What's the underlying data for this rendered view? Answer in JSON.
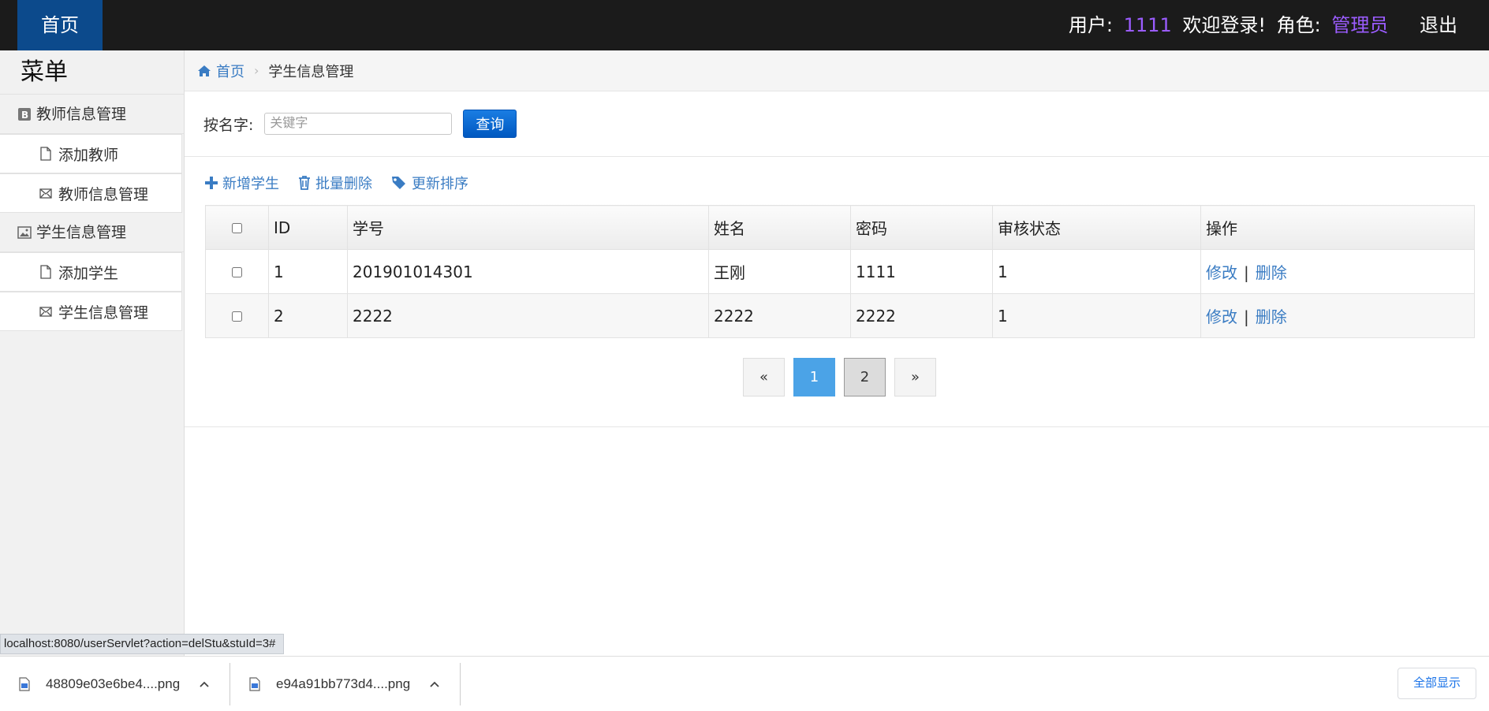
{
  "topbar": {
    "home": "首页",
    "user_label": "用户:",
    "user_name": "1111",
    "welcome": "欢迎登录!",
    "role_label": "角色:",
    "role_name": "管理员",
    "logout": "退出",
    "accent": "#9b5cff"
  },
  "sidebar": {
    "title": "菜单",
    "groups": [
      {
        "label": "教师信息管理",
        "icon": "bootstrap-icon",
        "items": [
          {
            "label": "添加教师",
            "icon": "file-icon"
          },
          {
            "label": "教师信息管理",
            "icon": "envelope-icon"
          }
        ]
      },
      {
        "label": "学生信息管理",
        "icon": "picture-icon",
        "items": [
          {
            "label": "添加学生",
            "icon": "file-icon"
          },
          {
            "label": "学生信息管理",
            "icon": "envelope-icon"
          }
        ]
      }
    ]
  },
  "breadcrumb": {
    "home": "首页",
    "current": "学生信息管理"
  },
  "search": {
    "label": "按名字:",
    "placeholder": "关键字",
    "value": "",
    "button": "查询"
  },
  "actions": {
    "add": "新增学生",
    "batch_delete": "批量删除",
    "reorder": "更新排序"
  },
  "table": {
    "headers": [
      "ID",
      "学号",
      "姓名",
      "密码",
      "审核状态",
      "操作"
    ],
    "rows": [
      {
        "id": "1",
        "sno": "201901014301",
        "name": "王刚",
        "password": "1111",
        "status": "1",
        "edit": "修改",
        "sep": "|",
        "delete": "删除"
      },
      {
        "id": "2",
        "sno": "2222",
        "name": "2222",
        "password": "2222",
        "status": "1",
        "edit": "修改",
        "sep": "|",
        "delete": "删除"
      }
    ]
  },
  "pagination": {
    "prev": "«",
    "pages": [
      "1",
      "2"
    ],
    "active": "1",
    "next": "»"
  },
  "status_url": "localhost:8080/userServlet?action=delStu&stuId=3#",
  "downloads": {
    "items": [
      "48809e03e6be4....png",
      "e94a91bb773d4....png"
    ],
    "show_all": "全部显示"
  }
}
